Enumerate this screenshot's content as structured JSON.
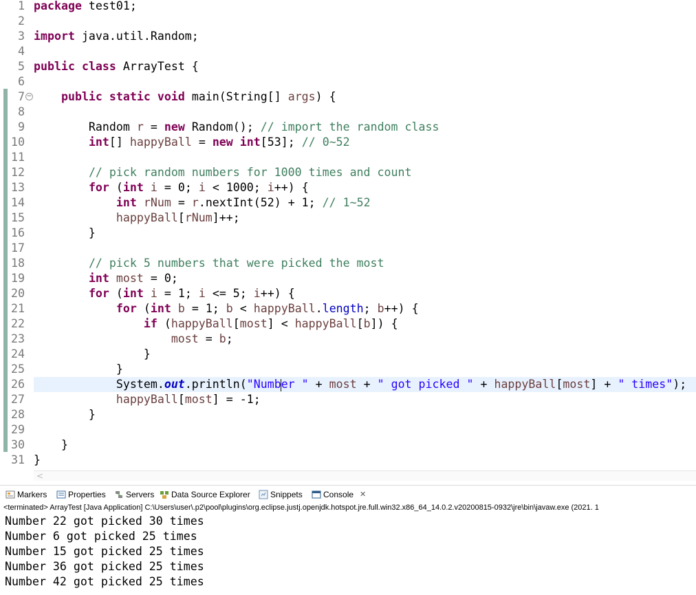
{
  "editor": {
    "lines": [
      {
        "n": "1",
        "html": "<span class=\"kw\">package</span> test01;"
      },
      {
        "n": "2",
        "html": ""
      },
      {
        "n": "3",
        "html": "<span class=\"kw\">import</span> java.util.Random;"
      },
      {
        "n": "4",
        "html": ""
      },
      {
        "n": "5",
        "html": "<span class=\"kw\">public</span> <span class=\"kw\">class</span> ArrayTest {"
      },
      {
        "n": "6",
        "html": ""
      },
      {
        "n": "7",
        "html": "    <span class=\"kw\">public</span> <span class=\"kw\">static</span> <span class=\"kw\">void</span> main(String[] <span class=\"var\">args</span>) {",
        "fold": true
      },
      {
        "n": "8",
        "html": ""
      },
      {
        "n": "9",
        "html": "        Random <span class=\"var\">r</span> = <span class=\"kw\">new</span> Random(); <span class=\"cm\">// import the random class</span>"
      },
      {
        "n": "10",
        "html": "        <span class=\"kw\">int</span>[] <span class=\"var\">happyBall</span> = <span class=\"kw\">new</span> <span class=\"kw\">int</span>[53]; <span class=\"cm\">// 0~52</span>"
      },
      {
        "n": "11",
        "html": ""
      },
      {
        "n": "12",
        "html": "        <span class=\"cm\">// pick random numbers for 1000 times and count</span>"
      },
      {
        "n": "13",
        "html": "        <span class=\"kw\">for</span> (<span class=\"kw\">int</span> <span class=\"var\">i</span> = 0; <span class=\"var\">i</span> &lt; 1000; <span class=\"var\">i</span>++) {"
      },
      {
        "n": "14",
        "html": "            <span class=\"kw\">int</span> <span class=\"var\">rNum</span> = <span class=\"var\">r</span>.nextInt(52) + 1; <span class=\"cm\">// 1~52</span>"
      },
      {
        "n": "15",
        "html": "            <span class=\"var\">happyBall</span>[<span class=\"var\">rNum</span>]++;"
      },
      {
        "n": "16",
        "html": "        }"
      },
      {
        "n": "17",
        "html": ""
      },
      {
        "n": "18",
        "html": "        <span class=\"cm\">// pick 5 numbers that were picked the most</span>"
      },
      {
        "n": "19",
        "html": "        <span class=\"kw\">int</span> <span class=\"var\">most</span> = 0;"
      },
      {
        "n": "20",
        "html": "        <span class=\"kw\">for</span> (<span class=\"kw\">int</span> <span class=\"var\">i</span> = 1; <span class=\"var\">i</span> &lt;= 5; <span class=\"var\">i</span>++) {"
      },
      {
        "n": "21",
        "html": "            <span class=\"kw\">for</span> (<span class=\"kw\">int</span> <span class=\"var\">b</span> = 1; <span class=\"var\">b</span> &lt; <span class=\"var\">happyBall</span>.<span class=\"mem\">length</span>; <span class=\"var\">b</span>++) {"
      },
      {
        "n": "22",
        "html": "                <span class=\"kw\">if</span> (<span class=\"var\">happyBall</span>[<span class=\"var\">most</span>] &lt; <span class=\"var\">happyBall</span>[<span class=\"var\">b</span>]) {"
      },
      {
        "n": "23",
        "html": "                    <span class=\"var\">most</span> = <span class=\"var\">b</span>;"
      },
      {
        "n": "24",
        "html": "                }"
      },
      {
        "n": "25",
        "html": "            }"
      },
      {
        "n": "26",
        "html": "            System.<span class=\"fld\">out</span>.println(<span class=\"st\">\"Numb<span class=\"caret\"></span>er \"</span> + <span class=\"var\">most</span> + <span class=\"st\">\" got picked \"</span> + <span class=\"var\">happyBall</span>[<span class=\"var\">most</span>] + <span class=\"st\">\" times\"</span>);",
        "current": true
      },
      {
        "n": "27",
        "html": "            <span class=\"var\">happyBall</span>[<span class=\"var\">most</span>] = -1;"
      },
      {
        "n": "28",
        "html": "        }"
      },
      {
        "n": "29",
        "html": ""
      },
      {
        "n": "30",
        "html": "    }"
      },
      {
        "n": "31",
        "html": "}"
      }
    ]
  },
  "views": {
    "tabs": [
      {
        "label": "Markers",
        "icon": "markers-icon"
      },
      {
        "label": "Properties",
        "icon": "properties-icon"
      },
      {
        "label": "Servers",
        "icon": "servers-icon"
      },
      {
        "label": "Data Source Explorer",
        "icon": "data-source-explorer-icon"
      },
      {
        "label": "Snippets",
        "icon": "snippets-icon"
      },
      {
        "label": "Console",
        "icon": "console-icon",
        "active": true
      }
    ],
    "close_glyph": "✕"
  },
  "console": {
    "status": "<terminated> ArrayTest [Java Application] C:\\Users\\user\\.p2\\pool\\plugins\\org.eclipse.justj.openjdk.hotspot.jre.full.win32.x86_64_14.0.2.v20200815-0932\\jre\\bin\\javaw.exe  (2021. 1",
    "output": [
      "Number 22 got picked 30 times",
      "Number 6 got picked 25 times",
      "Number 15 got picked 25 times",
      "Number 36 got picked 25 times",
      "Number 42 got picked 25 times"
    ]
  },
  "colors": {
    "keyword": "#7f0055",
    "comment": "#3f7f5f",
    "string": "#2a00ff",
    "current_line": "#e8f2fe",
    "change_bar": "#8fb3a6"
  }
}
